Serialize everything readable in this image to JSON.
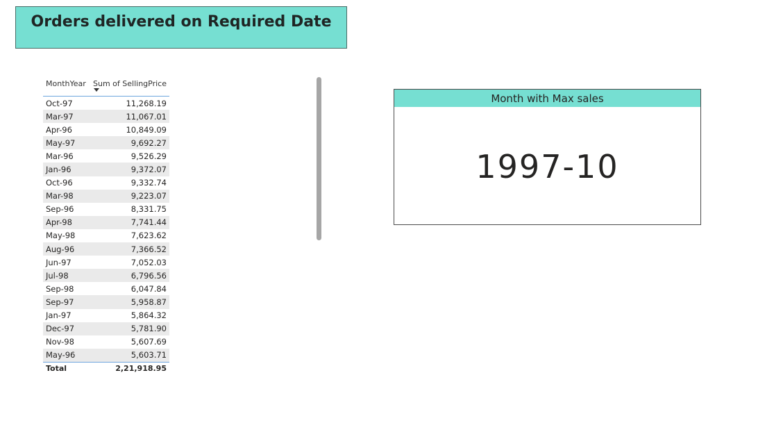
{
  "header": {
    "title": "Orders delivered on Required Date"
  },
  "table": {
    "columns": [
      "MonthYear",
      "Sum of SellingPrice"
    ],
    "rows": [
      [
        "Oct-97",
        "11,268.19"
      ],
      [
        "Mar-97",
        "11,067.01"
      ],
      [
        "Apr-96",
        "10,849.09"
      ],
      [
        "May-97",
        "9,692.27"
      ],
      [
        "Mar-96",
        "9,526.29"
      ],
      [
        "Jan-96",
        "9,372.07"
      ],
      [
        "Oct-96",
        "9,332.74"
      ],
      [
        "Mar-98",
        "9,223.07"
      ],
      [
        "Sep-96",
        "8,331.75"
      ],
      [
        "Apr-98",
        "7,741.44"
      ],
      [
        "May-98",
        "7,623.62"
      ],
      [
        "Aug-96",
        "7,366.52"
      ],
      [
        "Jun-97",
        "7,052.03"
      ],
      [
        "Jul-98",
        "6,796.56"
      ],
      [
        "Sep-98",
        "6,047.84"
      ],
      [
        "Sep-97",
        "5,958.87"
      ],
      [
        "Jan-97",
        "5,864.32"
      ],
      [
        "Dec-97",
        "5,781.90"
      ],
      [
        "Nov-98",
        "5,607.69"
      ],
      [
        "May-96",
        "5,603.71"
      ]
    ],
    "total_label": "Total",
    "total_value": "2,21,918.95",
    "sort_icon": "sort-descending-icon"
  },
  "card": {
    "title": "Month with Max sales",
    "value": "1997-10"
  },
  "colors": {
    "accent": "#76dfd2",
    "row_alt": "#eaeaea",
    "divider": "#6ea6de"
  }
}
